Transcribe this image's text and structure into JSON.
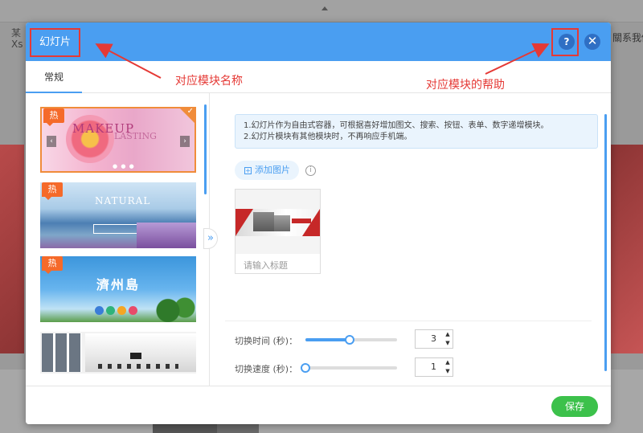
{
  "background": {
    "left_text_line1": "某",
    "left_text_line2": "Xs",
    "right_text": "關系我們"
  },
  "dialog": {
    "title": "幻灯片",
    "help_label": "?",
    "close_label": "✕",
    "tab_general": "常规",
    "notice_line1": "1.幻灯片作为自由式容器，可根据喜好增加图文、搜索、按钮、表单、数字递增模块。",
    "notice_line2": "2.幻灯片模块有其他模块时，不再响应手机端。",
    "add_image_label": "添加图片",
    "image_caption_placeholder": "请输入标题",
    "switch_time_label": "切换时间 (秒)：",
    "switch_time_value": "3",
    "switch_time_fraction": 0.48,
    "switch_speed_label": "切换速度 (秒)：",
    "switch_speed_value": "1",
    "switch_speed_fraction": 0.0,
    "save_label": "保存"
  },
  "templates": [
    {
      "badge": "热",
      "text": "MAKEUP",
      "subtext": "LASTING",
      "selected": true
    },
    {
      "badge": "热",
      "text": "NATURAL"
    },
    {
      "badge": "热",
      "text": "濟州島"
    },
    {
      "badge": ""
    }
  ],
  "annotations": {
    "module_name": "对应模块名称",
    "module_help": "对应模块的帮助"
  },
  "colors": {
    "header": "#4a9ef1",
    "annotation": "#e53935",
    "save": "#3cc14b",
    "hot_badge": "#f56a2a"
  }
}
